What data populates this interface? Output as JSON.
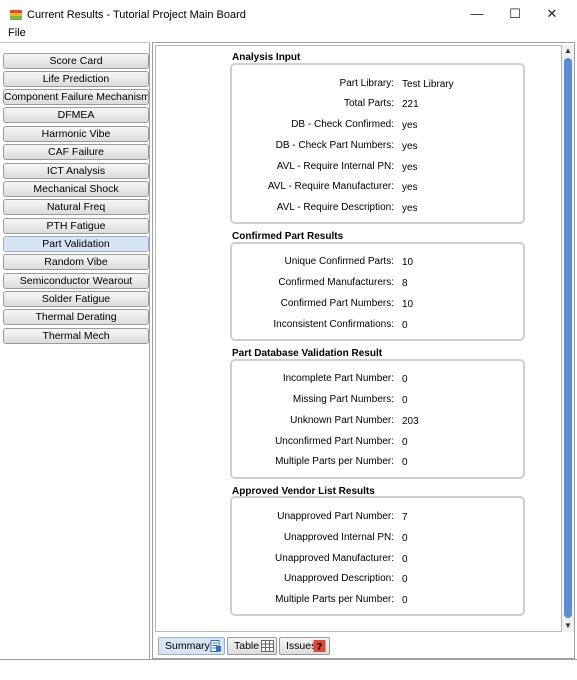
{
  "window": {
    "title": "Current Results - Tutorial Project Main Board",
    "minimize_symbol": "—",
    "maximize_symbol": "☐",
    "close_symbol": "✕"
  },
  "menu": {
    "file_label": "File"
  },
  "sidebar": {
    "items": [
      {
        "label": "Score Card",
        "selected": false
      },
      {
        "label": "Life Prediction",
        "selected": false
      },
      {
        "label": "Component Failure Mechanism",
        "selected": false
      },
      {
        "label": "DFMEA",
        "selected": false
      },
      {
        "label": "Harmonic Vibe",
        "selected": false
      },
      {
        "label": "CAF Failure",
        "selected": false
      },
      {
        "label": "ICT Analysis",
        "selected": false
      },
      {
        "label": "Mechanical Shock",
        "selected": false
      },
      {
        "label": "Natural Freq",
        "selected": false
      },
      {
        "label": "PTH Fatigue",
        "selected": false
      },
      {
        "label": "Part Validation",
        "selected": true
      },
      {
        "label": "Random Vibe",
        "selected": false
      },
      {
        "label": "Semiconductor Wearout",
        "selected": false
      },
      {
        "label": "Solder Fatigue",
        "selected": false
      },
      {
        "label": "Thermal Derating",
        "selected": false
      },
      {
        "label": "Thermal Mech",
        "selected": false
      }
    ]
  },
  "sections": {
    "analysis_input": {
      "title": "Analysis Input",
      "rows": [
        {
          "label": "Part Library:",
          "value": "Test Library"
        },
        {
          "label": "Total Parts:",
          "value": "221"
        },
        {
          "label": "DB - Check Confirmed:",
          "value": "yes"
        },
        {
          "label": "DB - Check Part Numbers:",
          "value": "yes"
        },
        {
          "label": "AVL - Require Internal PN:",
          "value": "yes"
        },
        {
          "label": "AVL - Require Manufacturer:",
          "value": "yes"
        },
        {
          "label": "AVL - Require Description:",
          "value": "yes"
        }
      ]
    },
    "confirmed_part_results": {
      "title": "Confirmed Part Results",
      "rows": [
        {
          "label": "Unique Confirmed Parts:",
          "value": "10"
        },
        {
          "label": "Confirmed Manufacturers:",
          "value": "8"
        },
        {
          "label": "Confirmed Part Numbers:",
          "value": "10"
        },
        {
          "label": "Inconsistent Confirmations:",
          "value": "0"
        }
      ]
    },
    "part_database_validation": {
      "title": "Part Database Validation Result",
      "rows": [
        {
          "label": "Incomplete Part Number:",
          "value": "0"
        },
        {
          "label": "Missing Part Numbers:",
          "value": "0"
        },
        {
          "label": "Unknown Part Number:",
          "value": "203"
        },
        {
          "label": "Unconfirmed Part Number:",
          "value": "0"
        },
        {
          "label": "Multiple Parts per Number:",
          "value": "0"
        }
      ]
    },
    "approved_vendor_list": {
      "title": "Approved Vendor List Results",
      "rows": [
        {
          "label": "Unapproved Part Number:",
          "value": "7"
        },
        {
          "label": "Unapproved Internal PN:",
          "value": "0"
        },
        {
          "label": "Unapproved Manufacturer:",
          "value": "0"
        },
        {
          "label": "Unapproved Description:",
          "value": "0"
        },
        {
          "label": "Multiple Parts per Number:",
          "value": "0"
        }
      ]
    }
  },
  "tabs": [
    {
      "label": "Summary",
      "icon": "document-icon",
      "selected": true
    },
    {
      "label": "Table",
      "icon": "grid-icon",
      "selected": false
    },
    {
      "label": "Issues",
      "icon": "question-icon",
      "selected": false
    }
  ],
  "scrollbar": {
    "up_symbol": "▲",
    "down_symbol": "▼"
  },
  "colors": {
    "selected_item": "#d7e4f4",
    "scroll_thumb": "#5a8fd0",
    "issues_icon": "#e0483a"
  }
}
